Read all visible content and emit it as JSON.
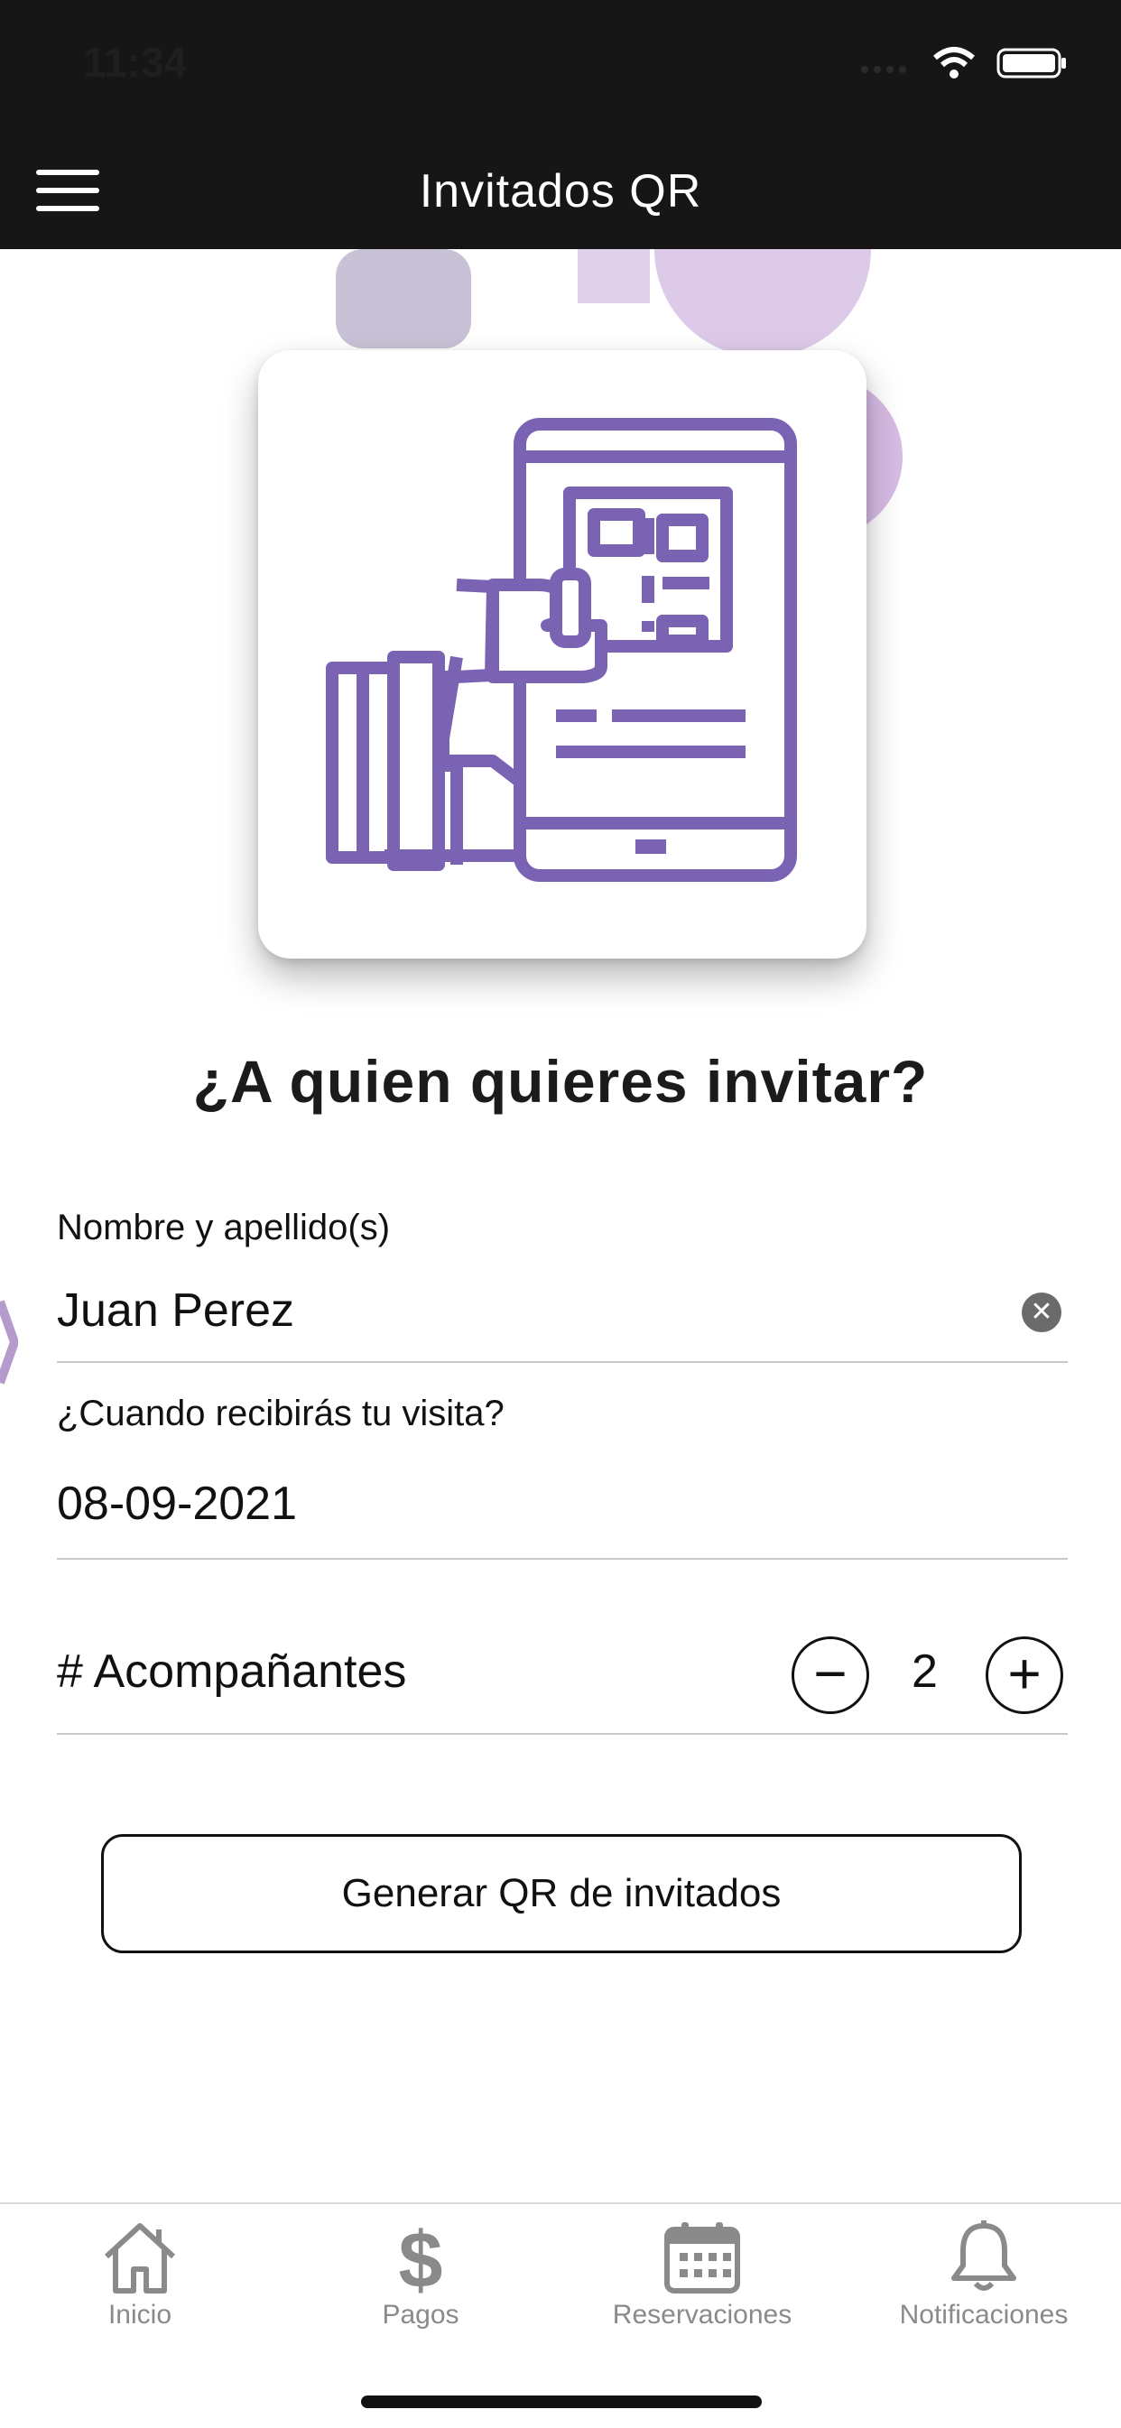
{
  "status": {
    "time": "11:34"
  },
  "nav": {
    "title": "Invitados QR"
  },
  "main": {
    "heading": "¿A quien quieres invitar?",
    "name_field": {
      "label": "Nombre y apellido(s)",
      "value": "Juan Perez"
    },
    "date_field": {
      "label": "¿Cuando recibirás tu visita?",
      "value": "08-09-2021"
    },
    "companions": {
      "label": "# Acompañantes",
      "count": "2",
      "minus": "−",
      "plus": "+"
    },
    "generate_label": "Generar QR de invitados"
  },
  "tabs": [
    {
      "label": "Inicio",
      "icon": "home-icon"
    },
    {
      "label": "Pagos",
      "icon": "dollar-icon"
    },
    {
      "label": "Reservaciones",
      "icon": "calendar-icon"
    },
    {
      "label": "Notificaciones",
      "icon": "bell-icon"
    }
  ],
  "colors": {
    "accent": "#7b63b3",
    "header_bg": "#161616"
  }
}
